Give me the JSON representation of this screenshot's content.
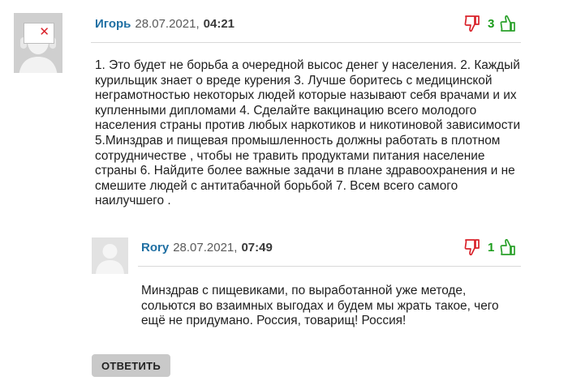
{
  "comments": [
    {
      "author": "Игорь",
      "date": "28.07.2021,",
      "time": "04:21",
      "votes": "3",
      "avatar_mark": "✕",
      "text": "1. Это будет не борьба а очередной высос денег у населения. 2. Каждый курильщик знает о вреде курения 3. Лучше боритесь с медицинской неграмотностью некоторых людей которые называют себя врачами и их купленными дипломами 4. Сделайте вакцинацию всего молодого населения страны против любых наркотиков и никотиновой зависимости 5.Минздрав и пищевая промышленность должны работать в плотном сотрудничестве , чтобы не травить продуктами питания население страны 6. Найдите более важные задачи в плане здравоохранения и не смешите людей с антитабачной борьбой 7. Всем всего самого наилучшего ."
    },
    {
      "author": "Rory",
      "date": "28.07.2021,",
      "time": "07:49",
      "votes": "1",
      "text": "Минздрав с пищевиками, по выработанной уже методе, сольются во взаимных выгодах и будем мы жрать такое, чего ещё не придумано. Россия, товарищ! Россия!"
    }
  ],
  "reply_button_label": "ОТВЕТИТЬ",
  "icons": {
    "dislike": "thumbs-down-icon",
    "like": "thumbs-up-icon"
  },
  "colors": {
    "author": "#1f6fa3",
    "dislike": "#d9222a",
    "like": "#2aa12a",
    "vote_count": "#1a9c1a"
  }
}
